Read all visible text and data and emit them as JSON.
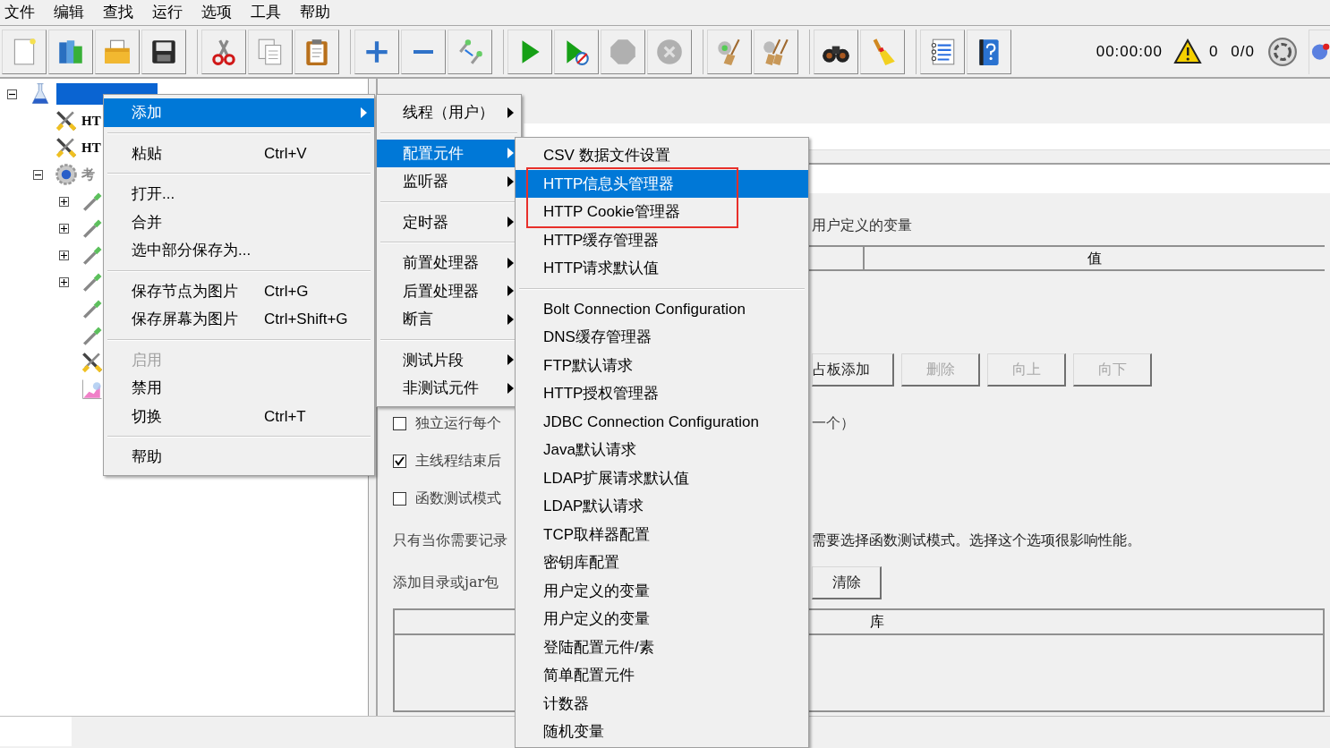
{
  "menu_bar": [
    "文件",
    "编辑",
    "查找",
    "运行",
    "选项",
    "工具",
    "帮助"
  ],
  "toolbar": {
    "timer": "00:00:00",
    "warnings": "0",
    "threads": "0/0"
  },
  "tree": {
    "kind": "flask",
    "selected": true,
    "expanded": true,
    "children": [
      {
        "kind": "tool",
        "label": "HT",
        "selected": false
      },
      {
        "kind": "tool",
        "label": "HT",
        "selected": false
      },
      {
        "kind": "gear",
        "label": "考",
        "selected": false,
        "expanded": true,
        "children": [
          {
            "kind": "pipette",
            "selected": false,
            "expanded": false
          },
          {
            "kind": "pipette",
            "selected": false,
            "expanded": false
          },
          {
            "kind": "pipette",
            "selected": false,
            "expanded": false
          },
          {
            "kind": "pipette",
            "selected": false,
            "expanded": false
          },
          {
            "kind": "pipette",
            "selected": false
          },
          {
            "kind": "pipette",
            "selected": false
          },
          {
            "kind": "tool",
            "selected": false
          },
          {
            "kind": "chart",
            "selected": false
          }
        ]
      }
    ]
  },
  "panel": {
    "variables_label": "用户定义的变量",
    "variables_columns": [
      "",
      "值"
    ],
    "table_buttons": [
      {
        "label": "占板添加",
        "disabled": false
      },
      {
        "label": "删除",
        "disabled": true
      },
      {
        "label": "向上",
        "disabled": true
      },
      {
        "label": "向下",
        "disabled": true
      }
    ],
    "options": [
      {
        "label": "独立运行每个",
        "trailing": "一个）",
        "checked": false
      },
      {
        "label": "主线程结束后",
        "checked": true
      },
      {
        "label": "函数测试模式",
        "checked": false
      }
    ],
    "note_start": "只有当你需要记录",
    "note_end": "需要选择函数测试模式。选择这个选项很影响性能。",
    "classpath_label": "添加目录或jar包",
    "clear_button": "清除",
    "library_column": "库"
  },
  "menus": [
    {
      "groups": [
        [
          {
            "label": "添加",
            "selected": true,
            "submenu": true
          }
        ],
        [
          {
            "label": "粘贴",
            "shortcut": "Ctrl+V",
            "selected": false
          }
        ],
        [
          {
            "label": "打开...",
            "selected": false
          },
          {
            "label": "合并",
            "selected": false
          },
          {
            "label": "选中部分保存为...",
            "selected": false
          }
        ],
        [
          {
            "label": "保存节点为图片",
            "shortcut": "Ctrl+G",
            "selected": false
          },
          {
            "label": "保存屏幕为图片",
            "shortcut": "Ctrl+Shift+G",
            "selected": false
          }
        ],
        [
          {
            "label": "启用",
            "selected": false,
            "disabled": true
          },
          {
            "label": "禁用",
            "selected": false,
            "disabled": false
          },
          {
            "label": "切换",
            "shortcut": "Ctrl+T",
            "selected": false,
            "disabled": false
          }
        ],
        [
          {
            "label": "帮助",
            "selected": false
          }
        ]
      ]
    },
    {
      "groups": [
        [
          {
            "label": "线程（用户）",
            "selected": false,
            "submenu": true
          }
        ],
        [
          {
            "label": "配置元件",
            "selected": true,
            "submenu": true
          },
          {
            "label": "监听器",
            "selected": false,
            "submenu": true
          }
        ],
        [
          {
            "label": "定时器",
            "selected": false,
            "submenu": true
          }
        ],
        [
          {
            "label": "前置处理器",
            "selected": false,
            "submenu": true
          },
          {
            "label": "后置处理器",
            "selected": false,
            "submenu": true
          },
          {
            "label": "断言",
            "selected": false,
            "submenu": true
          }
        ],
        [
          {
            "label": "测试片段",
            "selected": false,
            "submenu": true
          },
          {
            "label": "非测试元件",
            "selected": false,
            "submenu": true
          }
        ]
      ]
    },
    {
      "groups": [
        [
          {
            "label": "CSV 数据文件设置",
            "selected": false
          },
          {
            "label": "HTTP信息头管理器",
            "selected": true,
            "highlighted": true
          },
          {
            "label": "HTTP Cookie管理器",
            "selected": false,
            "highlighted": true
          },
          {
            "label": "HTTP缓存管理器",
            "selected": false
          },
          {
            "label": "HTTP请求默认值",
            "selected": false
          }
        ],
        [
          {
            "label": "Bolt Connection Configuration",
            "selected": false
          },
          {
            "label": "DNS缓存管理器",
            "selected": false
          },
          {
            "label": "FTP默认请求",
            "selected": false
          },
          {
            "label": "HTTP授权管理器",
            "selected": false
          },
          {
            "label": "JDBC Connection Configuration",
            "selected": false
          },
          {
            "label": "Java默认请求",
            "selected": false
          },
          {
            "label": "LDAP扩展请求默认值",
            "selected": false
          },
          {
            "label": "LDAP默认请求",
            "selected": false
          },
          {
            "label": "TCP取样器配置",
            "selected": false
          },
          {
            "label": "密钥库配置",
            "selected": false
          },
          {
            "label": "用户定义的变量",
            "selected": false
          },
          {
            "label": "用户定义的变量",
            "selected": false
          },
          {
            "label": "登陆配置元件/素",
            "selected": false
          },
          {
            "label": "简单配置元件",
            "selected": false
          },
          {
            "label": "计数器",
            "selected": false
          },
          {
            "label": "随机变量",
            "selected": false
          }
        ]
      ]
    }
  ]
}
